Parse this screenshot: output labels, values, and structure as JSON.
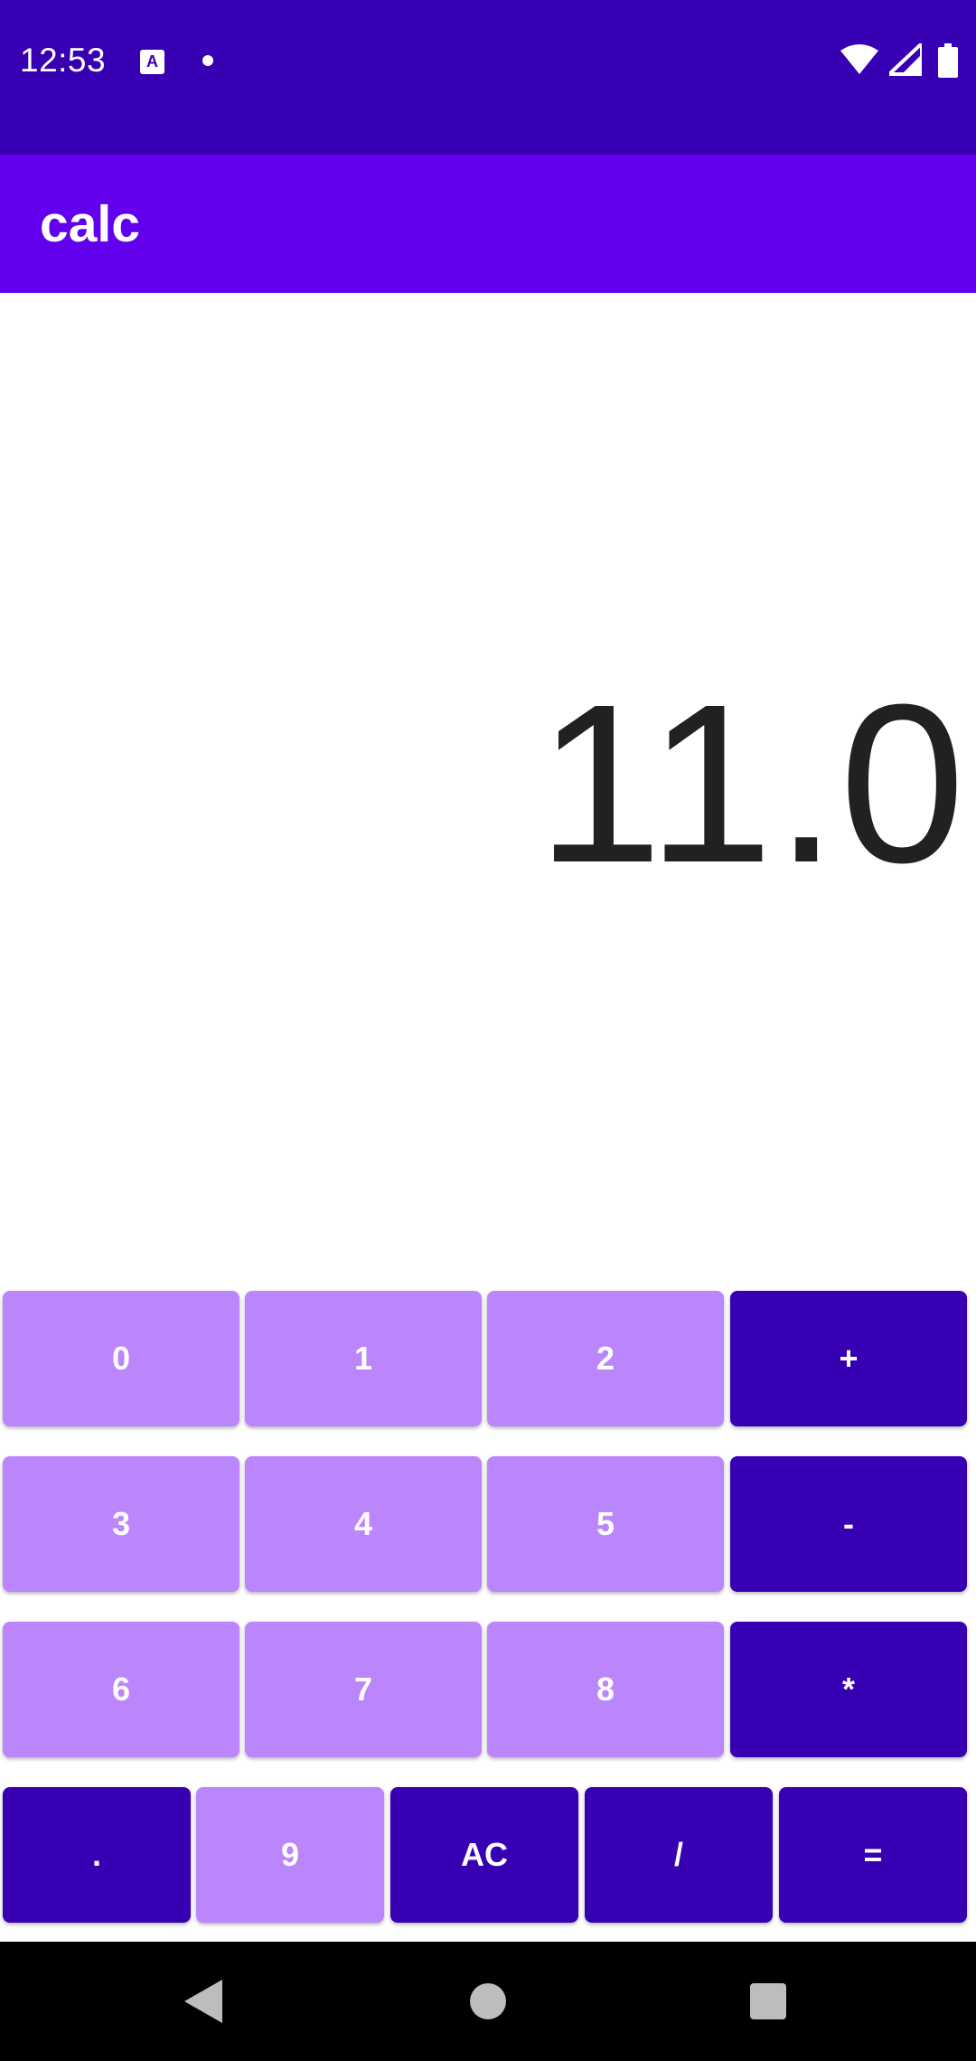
{
  "status_bar": {
    "time": "12:53",
    "icons": [
      "keyboard-a-icon",
      "notification-dot-icon",
      "wifi-icon",
      "cell-signal-icon",
      "battery-icon"
    ]
  },
  "app_bar": {
    "title": "calc"
  },
  "display": {
    "value": "11.0"
  },
  "keypad": {
    "row1": [
      "0",
      "1",
      "2",
      "+"
    ],
    "row2": [
      "3",
      "4",
      "5",
      "-"
    ],
    "row3": [
      "6",
      "7",
      "8",
      "*"
    ],
    "row4": [
      ".",
      "9",
      "AC",
      "/",
      "="
    ]
  },
  "nav_bar": {
    "icons": [
      "back-icon",
      "home-icon",
      "recents-icon"
    ]
  },
  "colors": {
    "status_bar": "#3700B3",
    "app_bar": "#6200EE",
    "key_light": "#BB86FC",
    "key_dark": "#3700B3",
    "display_text": "#212121"
  }
}
